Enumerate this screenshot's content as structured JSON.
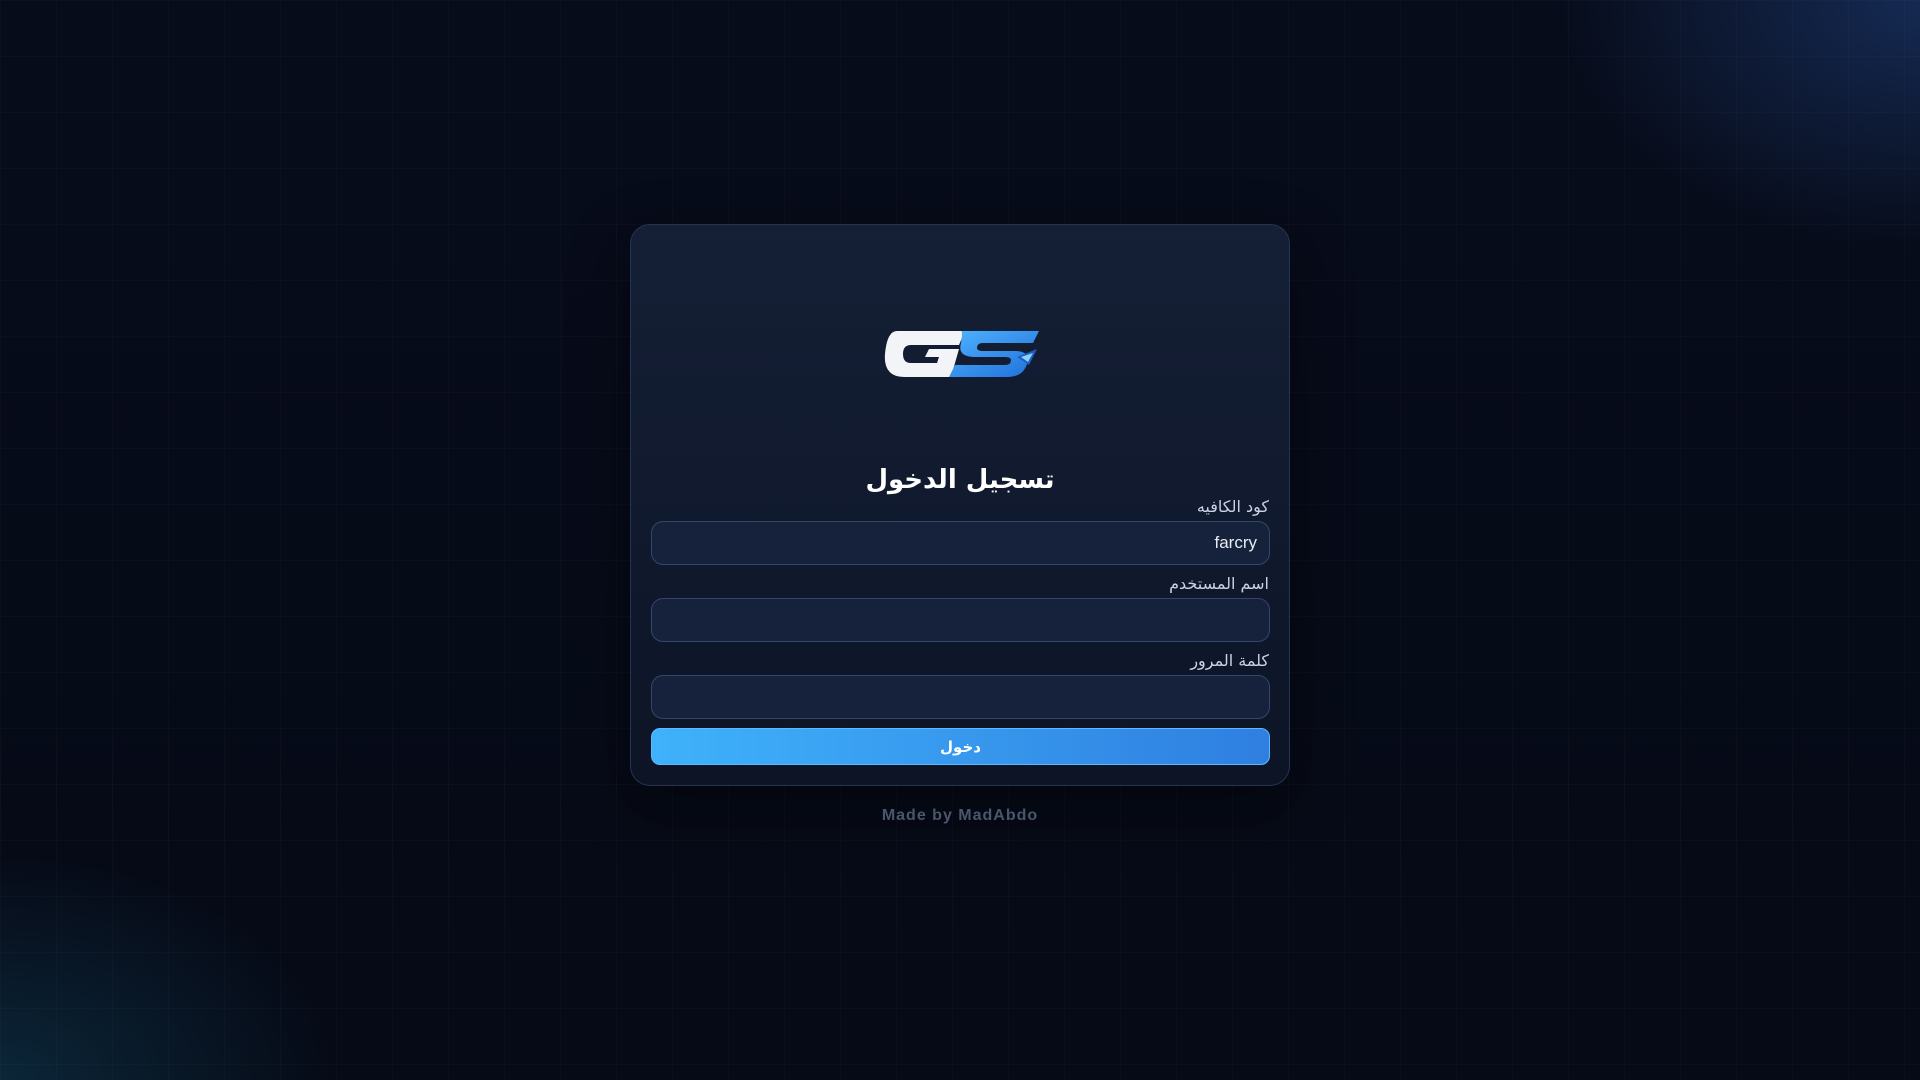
{
  "logo": {
    "text": "GS",
    "icon": "gs-logo-icon",
    "colors": {
      "g": "#f2f4f7",
      "s": "#2b8ff0"
    }
  },
  "login": {
    "title": "تسجيل الدخول",
    "cafe_code": {
      "label": "كود الكافيه",
      "value": "farcry",
      "placeholder": ""
    },
    "username": {
      "label": "اسم المستخدم",
      "value": "",
      "placeholder": ""
    },
    "password": {
      "label": "كلمة المرور",
      "value": "",
      "placeholder": ""
    },
    "submit_label": "دخول"
  },
  "footer": {
    "credit": "Made by MadAbdo"
  },
  "colors": {
    "background": "#060b18",
    "card": "#141f36",
    "accent_start": "#3fb2fb",
    "accent_end": "#2f7fe0"
  }
}
